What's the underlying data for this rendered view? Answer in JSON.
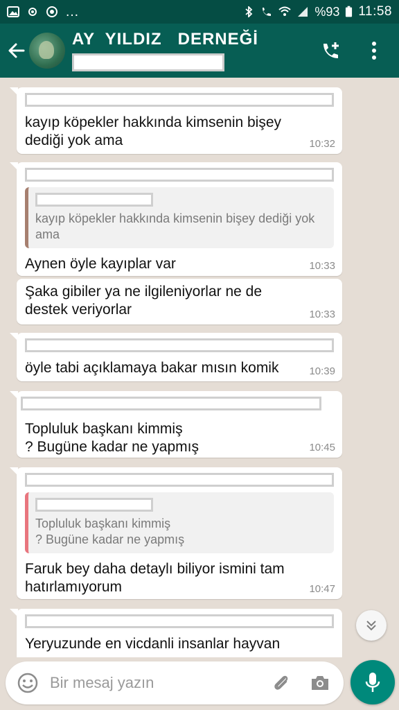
{
  "status_bar": {
    "battery": "%93",
    "time": "11:58",
    "left_icons": [
      "gallery-icon",
      "sync-icon",
      "chrome-icon",
      "more-dots"
    ],
    "right_icons": [
      "bluetooth-icon",
      "call-forward-icon",
      "wifi-icon",
      "signal-icon",
      "battery-icon"
    ]
  },
  "header": {
    "title": "AY  YILDIZ   DERNEĞİ"
  },
  "messages": [
    {
      "text": "kayıp köpekler hakkında kimsenin bişey dediği yok ama",
      "time": "10:32"
    },
    {
      "quote": "kayıp köpekler hakkında kimsenin bişey dediği yok ama",
      "text": "Aynen öyle kayıplar var",
      "time": "10:33"
    },
    {
      "text": "Şaka gibiler ya ne ilgileniyorlar ne de destek veriyorlar",
      "time": "10:33"
    },
    {
      "text": "öyle tabi açıklamaya bakar mısın komik",
      "time": "10:39"
    },
    {
      "text": "Topluluk başkanı kimmiş\n? Bugüne kadar ne yapmış",
      "time": "10:45"
    },
    {
      "quote": "Topluluk başkanı kimmiş\n? Bugüne kadar ne yapmış",
      "text": "Faruk bey daha detaylı biliyor ismini tam hatırlamıyorum",
      "time": "10:47"
    },
    {
      "text": "Yeryuzunde en vicdanli insanlar hayvan"
    }
  ],
  "composer": {
    "placeholder": "Bir mesaj yazın"
  },
  "colors": {
    "header": "#075e54",
    "status_bar": "#054d44",
    "chat_bg": "#e5ddd5",
    "mic_button": "#00897b"
  }
}
